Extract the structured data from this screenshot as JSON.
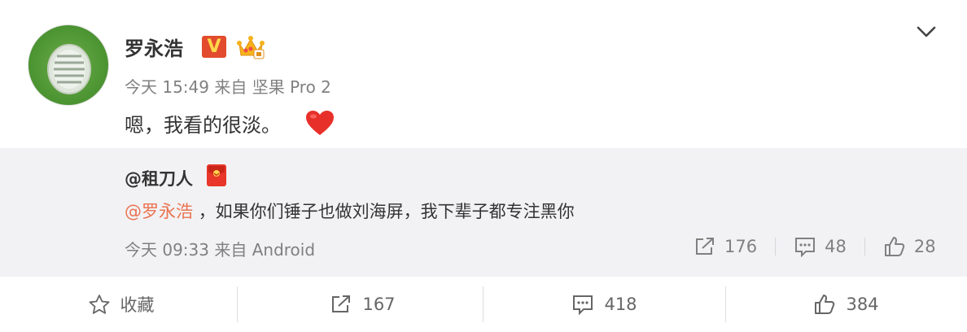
{
  "post": {
    "author": "罗永浩",
    "verified_badge": "V",
    "time": "今天 15:49",
    "source_prefix": "来自",
    "source": "坚果 Pro 2",
    "text": "嗯，我看的很淡。"
  },
  "repost": {
    "author": "@租刀人",
    "mention": "@罗永浩",
    "text": "，如果你们锤子也做刘海屏，我下辈子都专注黑你",
    "time": "今天 09:33",
    "source_prefix": "来自",
    "source": "Android",
    "share_count": "176",
    "comment_count": "48",
    "like_count": "28"
  },
  "footer": {
    "favorite_label": "收藏",
    "share_count": "167",
    "comment_count": "418",
    "like_count": "384"
  },
  "colors": {
    "mention": "#eb7350",
    "meta_gray": "#808080",
    "repost_bg": "#f2f2f5",
    "heart": "#e8302b"
  },
  "icons": [
    "avatar",
    "verified-v-icon",
    "crown-member-icon",
    "chevron-down-icon",
    "heart-emoji-icon",
    "red-packet-icon",
    "share-icon",
    "comment-icon",
    "like-icon",
    "star-icon"
  ]
}
